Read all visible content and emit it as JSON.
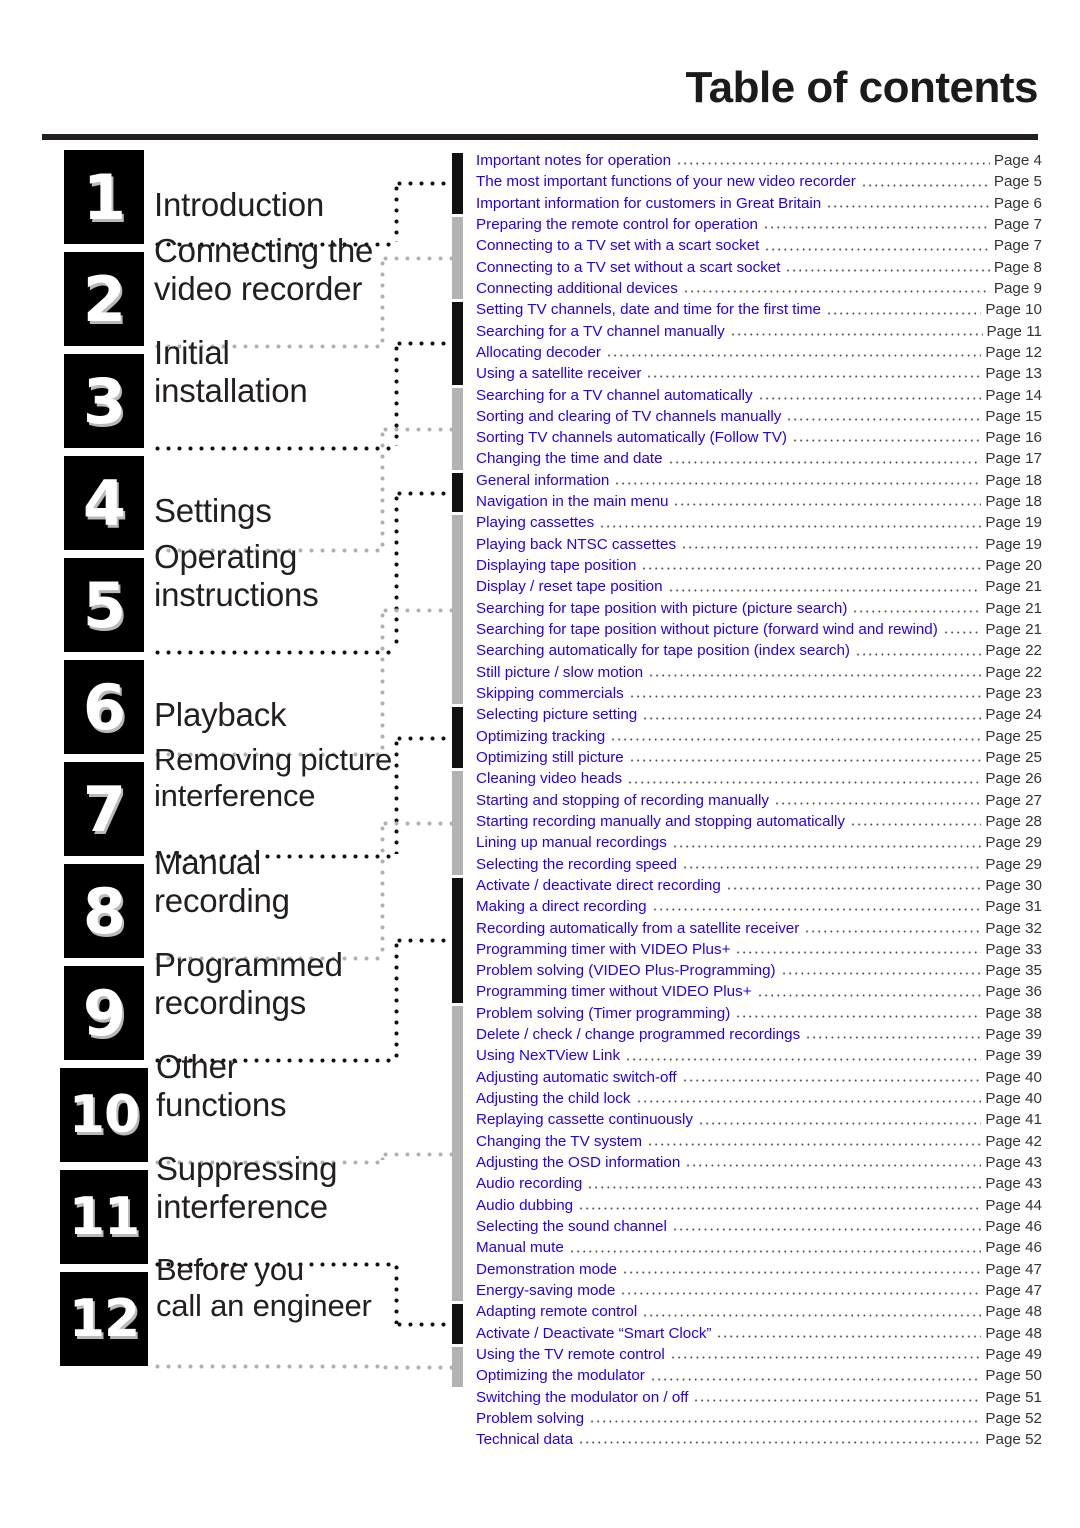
{
  "header": {
    "title": "Table of contents"
  },
  "sidebar": {
    "chapters": [
      {
        "number": "1",
        "title": "Introduction"
      },
      {
        "number": "2",
        "title": "Connecting the\nvideo recorder"
      },
      {
        "number": "3",
        "title": "Initial\ninstallation"
      },
      {
        "number": "4",
        "title": "Settings"
      },
      {
        "number": "5",
        "title": "Operating\ninstructions"
      },
      {
        "number": "6",
        "title": "Playback"
      },
      {
        "number": "7",
        "title": "Removing picture\ninterference"
      },
      {
        "number": "8",
        "title": "Manual\nrecording"
      },
      {
        "number": "9",
        "title": "Programmed\nrecordings"
      },
      {
        "number": "10",
        "title": "Other\nfunctions"
      },
      {
        "number": "11",
        "title": "Suppressing\ninterference"
      },
      {
        "number": "12",
        "title": "Before you\ncall an engineer"
      }
    ]
  },
  "toc": {
    "groups": [
      {
        "bar": "black",
        "count": 3
      },
      {
        "bar": "gray",
        "count": 4
      },
      {
        "bar": "black",
        "count": 4
      },
      {
        "bar": "gray",
        "count": 4
      },
      {
        "bar": "black",
        "count": 2
      },
      {
        "bar": "gray",
        "count": 9
      },
      {
        "bar": "black",
        "count": 3
      },
      {
        "bar": "gray",
        "count": 5
      },
      {
        "bar": "black",
        "count": 6
      },
      {
        "bar": "gray",
        "count": 14
      },
      {
        "bar": "black",
        "count": 2
      },
      {
        "bar": "gray",
        "count": 2
      }
    ],
    "entries": [
      {
        "label": "Important notes for operation",
        "page": "Page 4"
      },
      {
        "label": "The most important functions of your new video recorder",
        "page": "Page 5"
      },
      {
        "label": "Important information for customers in Great Britain",
        "page": "Page 6"
      },
      {
        "label": "Preparing the remote control for operation",
        "page": "Page 7"
      },
      {
        "label": "Connecting to a TV set with a scart socket",
        "page": "Page 7"
      },
      {
        "label": "Connecting to a TV set without a scart socket",
        "page": "Page 8"
      },
      {
        "label": "Connecting additional devices",
        "page": "Page 9"
      },
      {
        "label": "Setting TV channels, date and time for the  first time",
        "page": "Page 10"
      },
      {
        "label": "Searching for a TV channel manually",
        "page": "Page 11"
      },
      {
        "label": "Allocating decoder",
        "page": "Page 12"
      },
      {
        "label": "Using a satellite receiver",
        "page": "Page 13"
      },
      {
        "label": "Searching for a TV channel automatically",
        "page": "Page 14"
      },
      {
        "label": "Sorting and clearing of TV channels manually",
        "page": "Page 15"
      },
      {
        "label": "Sorting TV channels automatically (Follow TV)",
        "page": "Page 16"
      },
      {
        "label": "Changing the time and  date",
        "page": "Page 17"
      },
      {
        "label": "General information",
        "page": "Page 18"
      },
      {
        "label": "Navigation in the main menu",
        "page": "Page 18"
      },
      {
        "label": "Playing cassettes",
        "page": "Page 19"
      },
      {
        "label": "Playing back NTSC cassettes",
        "page": "Page 19"
      },
      {
        "label": "Displaying tape position",
        "page": "Page 20"
      },
      {
        "label": "Display / reset tape position",
        "page": "Page 21"
      },
      {
        "label": "Searching for tape position with picture (picture search)",
        "page": "Page 21"
      },
      {
        "label": "Searching for tape position without picture (forward wind and rewind)",
        "page": "Page 21"
      },
      {
        "label": "Searching automatically for tape position (index search)",
        "page": "Page 22"
      },
      {
        "label": "Still picture /  slow motion",
        "page": "Page 22"
      },
      {
        "label": "Skipping commercials",
        "page": "Page 23"
      },
      {
        "label": "Selecting picture setting",
        "page": "Page 24"
      },
      {
        "label": "Optimizing tracking",
        "page": "Page 25"
      },
      {
        "label": "Optimizing still picture",
        "page": "Page 25"
      },
      {
        "label": "Cleaning video heads",
        "page": "Page 26"
      },
      {
        "label": "Starting and stopping of recording manually",
        "page": "Page 27"
      },
      {
        "label": "Starting recording manually and stopping automatically",
        "page": "Page 28"
      },
      {
        "label": "Lining up manual recordings",
        "page": "Page 29"
      },
      {
        "label": "Selecting the recording speed",
        "page": "Page 29"
      },
      {
        "label": "Activate / deactivate direct recording",
        "page": "Page 30"
      },
      {
        "label": "Making a direct recording",
        "page": "Page 31"
      },
      {
        "label": "Recording automatically from a satellite receiver",
        "page": "Page 32"
      },
      {
        "label": "Programming timer with VIDEO Plus+",
        "page": "Page 33"
      },
      {
        "label": "Problem solving (VIDEO Plus-Programming)",
        "page": "Page 35"
      },
      {
        "label": "Programming timer without VIDEO Plus+",
        "page": "Page 36"
      },
      {
        "label": "Problem solving (Timer programming)",
        "page": "Page 38"
      },
      {
        "label": "Delete / check / change programmed recordings",
        "page": "Page 39"
      },
      {
        "label": "Using NexTView Link",
        "page": "Page 39"
      },
      {
        "label": "Adjusting automatic switch-off",
        "page": "Page 40"
      },
      {
        "label": "Adjusting the child lock",
        "page": "Page 40"
      },
      {
        "label": "Replaying cassette continuously",
        "page": "Page 41"
      },
      {
        "label": "Changing the TV system",
        "page": "Page 42"
      },
      {
        "label": "Adjusting the OSD information",
        "page": "Page 43"
      },
      {
        "label": "Audio recording",
        "page": "Page 43"
      },
      {
        "label": "Audio dubbing",
        "page": "Page 44"
      },
      {
        "label": "Selecting the sound channel",
        "page": "Page 46"
      },
      {
        "label": "Manual mute",
        "page": "Page 46"
      },
      {
        "label": "Demonstration mode",
        "page": "Page 47"
      },
      {
        "label": "Energy-saving mode",
        "page": "Page 47"
      },
      {
        "label": "Adapting remote control",
        "page": "Page 48"
      },
      {
        "label": "Activate / Deactivate “Smart Clock”",
        "page": "Page 48"
      },
      {
        "label": "Using the TV remote control",
        "page": "Page 49"
      },
      {
        "label": "Optimizing the modulator",
        "page": "Page 50"
      },
      {
        "label": "Switching the modulator on / off",
        "page": "Page 51"
      },
      {
        "label": "Problem solving",
        "page": "Page 52"
      },
      {
        "label": "Technical data",
        "page": "Page 52"
      }
    ]
  },
  "colors": {
    "entry_text": "#2200ee",
    "page_text": "#333333",
    "chapter_box": "#000000",
    "bar_black": "#111111",
    "bar_gray": "#b3b3b3"
  }
}
